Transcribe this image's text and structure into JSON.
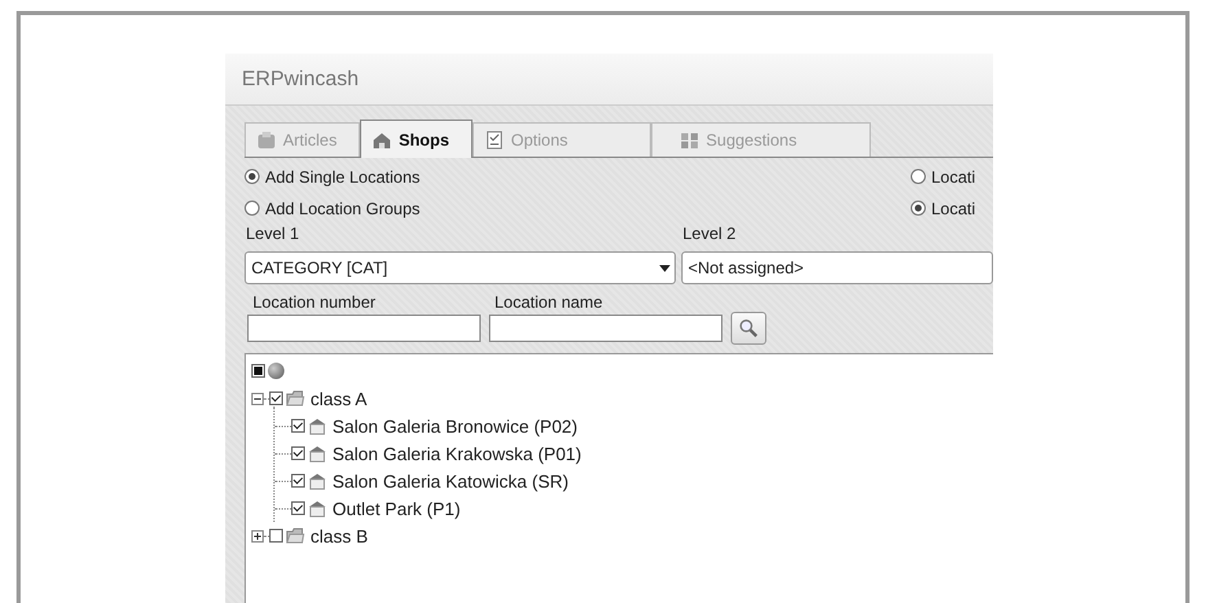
{
  "window": {
    "title": "ERPwincash"
  },
  "tabs": [
    {
      "label": "Articles",
      "selected": false
    },
    {
      "label": "Shops",
      "selected": true
    },
    {
      "label": "Options",
      "selected": false
    },
    {
      "label": "Suggestions",
      "selected": false
    }
  ],
  "mode_left": [
    {
      "label": "Add Single Locations",
      "selected": true
    },
    {
      "label": "Add Location Groups",
      "selected": false
    }
  ],
  "mode_right": [
    {
      "label": "Locati",
      "selected": false
    },
    {
      "label": "Locati",
      "selected": true
    }
  ],
  "levels": [
    {
      "label": "Level 1",
      "value": "CATEGORY [CAT]"
    },
    {
      "label": "Level 2",
      "value": "<Not assigned>"
    }
  ],
  "filters": [
    {
      "label": "Location number"
    },
    {
      "label": "Location name"
    }
  ],
  "tree": {
    "indeterminate": true,
    "children": [
      {
        "label": "class A",
        "checked": true,
        "expanded": true,
        "children": [
          {
            "label": "Salon Galeria Bronowice (P02)",
            "checked": true
          },
          {
            "label": "Salon Galeria Krakowska (P01)",
            "checked": true
          },
          {
            "label": "Salon Galeria Katowicka (SR)",
            "checked": true
          },
          {
            "label": "Outlet Park (P1)",
            "checked": true
          }
        ]
      },
      {
        "label": "class B",
        "checked": false,
        "expanded": false
      }
    ]
  }
}
